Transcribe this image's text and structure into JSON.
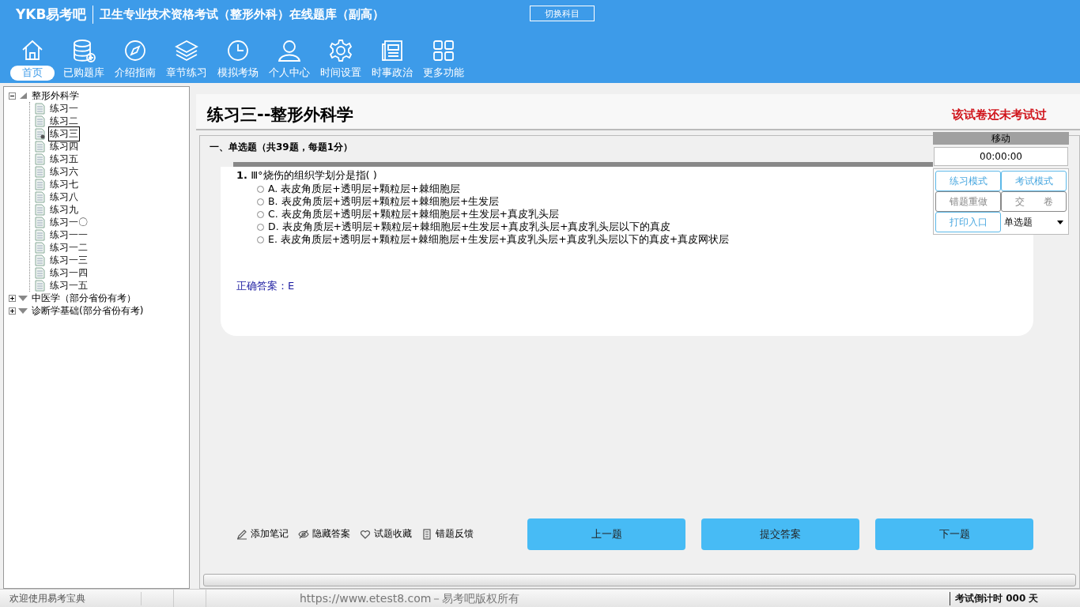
{
  "header": {
    "logo": "YKB易考吧",
    "title": "卫生专业技术资格考试（整形外科）在线题库（副高）",
    "switch_button": "切换科目"
  },
  "nav": [
    {
      "label": "首页",
      "selected": true
    },
    {
      "label": "已购题库",
      "selected": false
    },
    {
      "label": "介绍指南",
      "selected": false
    },
    {
      "label": "章节练习",
      "selected": false
    },
    {
      "label": "模拟考场",
      "selected": false
    },
    {
      "label": "个人中心",
      "selected": false
    },
    {
      "label": "时间设置",
      "selected": false
    },
    {
      "label": "时事政治",
      "selected": false
    },
    {
      "label": "更多功能",
      "selected": false
    }
  ],
  "tree": [
    {
      "label": "整形外科学",
      "expanded": true,
      "children": [
        {
          "label": "练习一",
          "selected": false
        },
        {
          "label": "练习二",
          "selected": false
        },
        {
          "label": "练习三",
          "selected": true
        },
        {
          "label": "练习四",
          "selected": false
        },
        {
          "label": "练习五",
          "selected": false
        },
        {
          "label": "练习六",
          "selected": false
        },
        {
          "label": "练习七",
          "selected": false
        },
        {
          "label": "练习八",
          "selected": false
        },
        {
          "label": "练习九",
          "selected": false
        },
        {
          "label": "练习一〇",
          "selected": false
        },
        {
          "label": "练习一一",
          "selected": false
        },
        {
          "label": "练习一二",
          "selected": false
        },
        {
          "label": "练习一三",
          "selected": false
        },
        {
          "label": "练习一四",
          "selected": false
        },
        {
          "label": "练习一五",
          "selected": false
        }
      ]
    },
    {
      "label": "中医学（部分省份有考）",
      "expanded": false
    },
    {
      "label": "诊断学基础(部分省份有考)",
      "expanded": false
    }
  ],
  "paper": {
    "title": "练习三--整形外科学",
    "status": "该试卷还未考试过",
    "section": "一、单选题（共39题，每题1分）"
  },
  "question": {
    "number": "1.",
    "text": "Ⅲ°烧伤的组织学划分是指( )",
    "options": [
      {
        "label": "A. 表皮角质层+透明层+颗粒层+棘细胞层",
        "selected": false
      },
      {
        "label": "B. 表皮角质层+透明层+颗粒层+棘细胞层+生发层",
        "selected": false
      },
      {
        "label": "C. 表皮角质层+透明层+颗粒层+棘细胞层+生发层+真皮乳头层",
        "selected": false
      },
      {
        "label": "D. 表皮角质层+透明层+颗粒层+棘细胞层+生发层+真皮乳头层+真皮乳头层以下的真皮",
        "selected": false
      },
      {
        "label": "E. 表皮角质层+透明层+颗粒层+棘细胞层+生发层+真皮乳头层+真皮乳头层以下的真皮+真皮网状层",
        "selected": false
      }
    ],
    "answer": "正确答案：E"
  },
  "panel": {
    "move": "移动",
    "timer": "00:00:00",
    "buttons": [
      {
        "label": "练习模式",
        "disabled": false
      },
      {
        "label": "考试模式",
        "disabled": false
      },
      {
        "label": "错题重做",
        "disabled": true
      },
      {
        "label": "交　　卷",
        "disabled": true
      },
      {
        "label": "打印入口",
        "disabled": false
      }
    ],
    "type_select": "单选题"
  },
  "tools": [
    "添加笔记",
    "隐藏答案",
    "试题收藏",
    "错题反馈"
  ],
  "actions": [
    "上一题",
    "提交答案",
    "下一题"
  ],
  "status_bar": {
    "welcome": "欢迎使用易考宝典",
    "copyright": "https://www.etest8.com－易考吧版权所有",
    "countdown": "考试倒计时 000 天"
  }
}
